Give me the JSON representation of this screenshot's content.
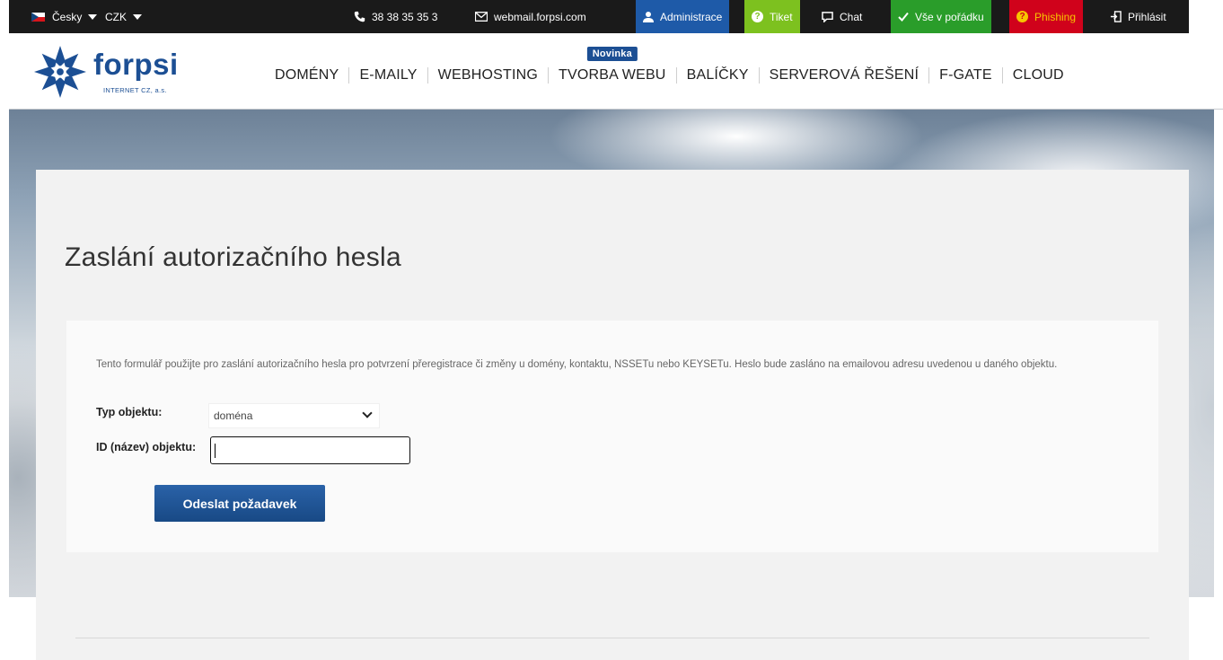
{
  "topbar": {
    "language": "Česky",
    "currency": "CZK",
    "phone": "38 38 35 35 3",
    "webmail": "webmail.forpsi.com",
    "administrace": "Administrace",
    "tiket": "Tiket",
    "chat": "Chat",
    "status": "Vše v pořádku",
    "phishing": "Phishing",
    "login": "Přihlásit"
  },
  "logo": {
    "brand": "forpsi",
    "company": "INTERNET CZ, a.s."
  },
  "nav": {
    "items": [
      "DOMÉNY",
      "E-MAILY",
      "WEBHOSTING",
      "TVORBA WEBU",
      "BALÍČKY",
      "SERVEROVÁ ŘEŠENÍ",
      "F-GATE",
      "CLOUD"
    ],
    "badge": "Novinka"
  },
  "main": {
    "title": "Zaslání autorizačního hesla",
    "description": "Tento formulář použijte pro zaslání autorizačního hesla pro potvrzení přeregistrace či změny u domény, kontaktu, NSSETu nebo KEYSETu. Heslo bude zasláno na emailovou adresu uvedenou u daného objektu.",
    "type_label": "Typ objektu:",
    "type_value": "doména",
    "id_label": "ID (název) objektu:",
    "id_value": "",
    "submit_label": "Odeslat požadavek"
  },
  "colors": {
    "brand_blue": "#1c4f94",
    "status_green": "#2a9d2a",
    "tiket_green": "#7dc11f",
    "phishing_red": "#d0021b"
  },
  "icons": [
    "flag-cz-icon",
    "caret-down-icon",
    "phone-icon",
    "mail-icon",
    "user-icon",
    "help-icon",
    "chat-icon",
    "check-icon",
    "login-icon",
    "chevron-down-icon"
  ]
}
